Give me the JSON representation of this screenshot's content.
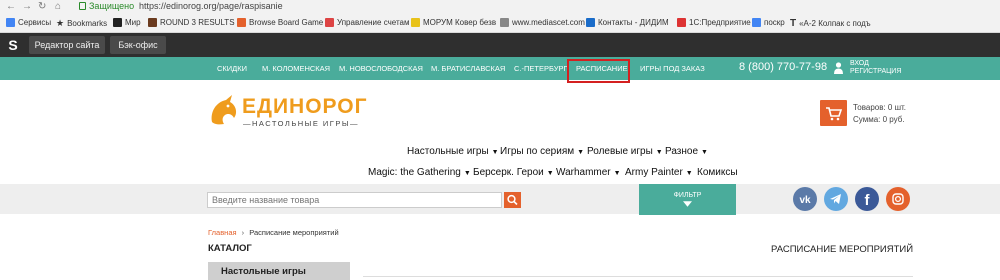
{
  "browser": {
    "secure_label": "Защищено",
    "url": "https://edinorog.org/page/raspisanie",
    "bookmarks": [
      {
        "label": "Сервисы",
        "color": "#4285f4"
      },
      {
        "label": "Bookmarks",
        "color": "#555555"
      },
      {
        "label": "Мир",
        "color": "#222222"
      },
      {
        "label": "ROUND 3 RESULTS |",
        "color": "#6b3b1f"
      },
      {
        "label": "Browse Board Game",
        "color": "#e4612c"
      },
      {
        "label": "Управление счетам",
        "color": "#d44"
      },
      {
        "label": "МОРУМ Ковер безв",
        "color": "#e8c21a"
      },
      {
        "label": "www.mediascet.com",
        "color": "#888888"
      },
      {
        "label": "Контакты - ДИДИМ",
        "color": "#1a6cc9"
      },
      {
        "label": "1С:Предприятие",
        "color": "#d33"
      },
      {
        "label": "поскр",
        "color": "#4285f4"
      },
      {
        "label": "«А-2 Колпак с подъ",
        "color": "#111111"
      }
    ]
  },
  "admin": {
    "logo": "S",
    "site_editor": "Редактор сайта",
    "back_office": "Бэк-офис"
  },
  "menu": {
    "items": [
      "СКИДКИ",
      "М. КОЛОМЕНСКАЯ",
      "М. НОВОСЛОБОДСКАЯ",
      "М. БРАТИСЛАВСКАЯ",
      "С.-ПЕТЕРБУРГ",
      "РАСПИСАНИЕ",
      "ИГРЫ ПОД ЗАКАЗ"
    ],
    "phone": "8 (800) 770-77-98",
    "login": "ВХОД",
    "register": "РЕГИСТРАЦИЯ",
    "highlight_color": "#d42020"
  },
  "header": {
    "brand": "ЕДИНОРОГ",
    "tagline": "—НАСТОЛЬНЫЕ ИГРЫ—",
    "goods": "Товаров: 0 шт.",
    "sum": "Сумма: 0 руб."
  },
  "categories": {
    "row1": [
      "Настольные игры",
      "Игры по сериям",
      "Ролевые игры",
      "Разное"
    ],
    "row2": [
      "Magic: the Gathering",
      "Берсерк. Герои",
      "Warhammer",
      "Army Painter",
      "Комиксы"
    ]
  },
  "search": {
    "placeholder": "Введите название товара",
    "filter": "ФИЛЬТР"
  },
  "social": [
    {
      "name": "vk",
      "color": "#5b7aa8"
    },
    {
      "name": "telegram",
      "color": "#62a8e0"
    },
    {
      "name": "facebook",
      "color": "#3b5998"
    },
    {
      "name": "instagram",
      "color": "#e4612c"
    }
  ],
  "content": {
    "breadcrumb_home": "Главная",
    "breadcrumb_current": "Расписание мероприятий",
    "catalog_title": "КАТАЛОГ",
    "catalog_first_item": "Настольные игры",
    "page_title": "РАСПИСАНИЕ МЕРОПРИЯТИЙ"
  },
  "colors": {
    "teal": "#4aac9b",
    "orange": "#ef9c1d",
    "accent": "#e4612c",
    "dark": "#2f2f2f"
  }
}
